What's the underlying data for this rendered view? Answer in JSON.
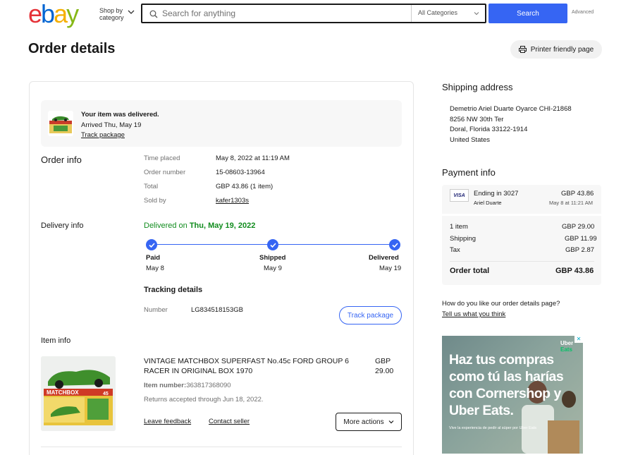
{
  "header": {
    "logo": [
      "e",
      "b",
      "a",
      "y"
    ],
    "logo_colors": [
      "#e53238",
      "#0064d2",
      "#f5af02",
      "#86b817"
    ],
    "shop_by": "Shop by",
    "shop_by_2": "category",
    "search_placeholder": "Search for anything",
    "category": "All Categories",
    "search_button": "Search",
    "advanced": "Advanced"
  },
  "page": {
    "title": "Order details",
    "print_button": "Printer friendly page"
  },
  "banner": {
    "headline": "Your item was delivered.",
    "arrived": "Arrived Thu, May 19",
    "track": "Track package"
  },
  "order_info": {
    "label": "Order info",
    "rows": [
      {
        "k": "Time placed",
        "v": "May 8, 2022 at 11:19 AM"
      },
      {
        "k": "Order number",
        "v": "15-08603-13964"
      },
      {
        "k": "Total",
        "v": "GBP 43.86 (1 item)"
      },
      {
        "k": "Sold by",
        "v": "kafer1303s"
      }
    ]
  },
  "delivery": {
    "label": "Delivery info",
    "status_prefix": "Delivered on ",
    "status_date": "Thu, May 19, 2022",
    "steps": [
      {
        "label": "Paid",
        "date": "May 8"
      },
      {
        "label": "Shipped",
        "date": "May 9"
      },
      {
        "label": "Delivered",
        "date": "May 19"
      }
    ],
    "tracking_title": "Tracking details",
    "number_label": "Number",
    "number_value": "LG834518153GB",
    "track_button": "Track package"
  },
  "item": {
    "label": "Item info",
    "title": "VINTAGE MATCHBOX SUPERFAST No.45c FORD GROUP 6 RACER IN ORIGINAL BOX 1970",
    "price_1": "GBP",
    "price_2": "29.00",
    "number_label": "Item number:",
    "number_value": "363817368090",
    "returns": "Returns accepted through Jun 18, 2022.",
    "leave_feedback": "Leave feedback",
    "contact_seller": "Contact seller",
    "more_actions": "More actions",
    "box_brand": "MATCHBOX",
    "box_num": "45"
  },
  "shipping": {
    "title": "Shipping address",
    "lines": [
      "Demetrio Ariel Duarte Oyarce CHI-21868",
      "8256 NW 30th Ter",
      "Doral, Florida 33122-1914",
      "United States"
    ]
  },
  "payment": {
    "title": "Payment info",
    "card_brand": "VISA",
    "ending": "Ending in 3027",
    "amount": "GBP 43.86",
    "holder": "Ariel Duarte",
    "date": "May 8 at 11:21 AM",
    "lines": [
      {
        "k": "1 item",
        "v": "GBP 29.00"
      },
      {
        "k": "Shipping",
        "v": "GBP 11.99"
      },
      {
        "k": "Tax",
        "v": "GBP 2.87"
      }
    ],
    "total_label": "Order total",
    "total_value": "GBP 43.86"
  },
  "feedback": {
    "question": "How do you like our order details page?",
    "link": "Tell us what you think"
  },
  "ad": {
    "headline": "Haz tus compras como tú las harías con Cornershop y Uber Eats.",
    "sub": "Vive la experiencia de pedir al súper por Uber Eats",
    "logo_1": "Uber",
    "logo_2": "Eats",
    "close": "✕"
  }
}
